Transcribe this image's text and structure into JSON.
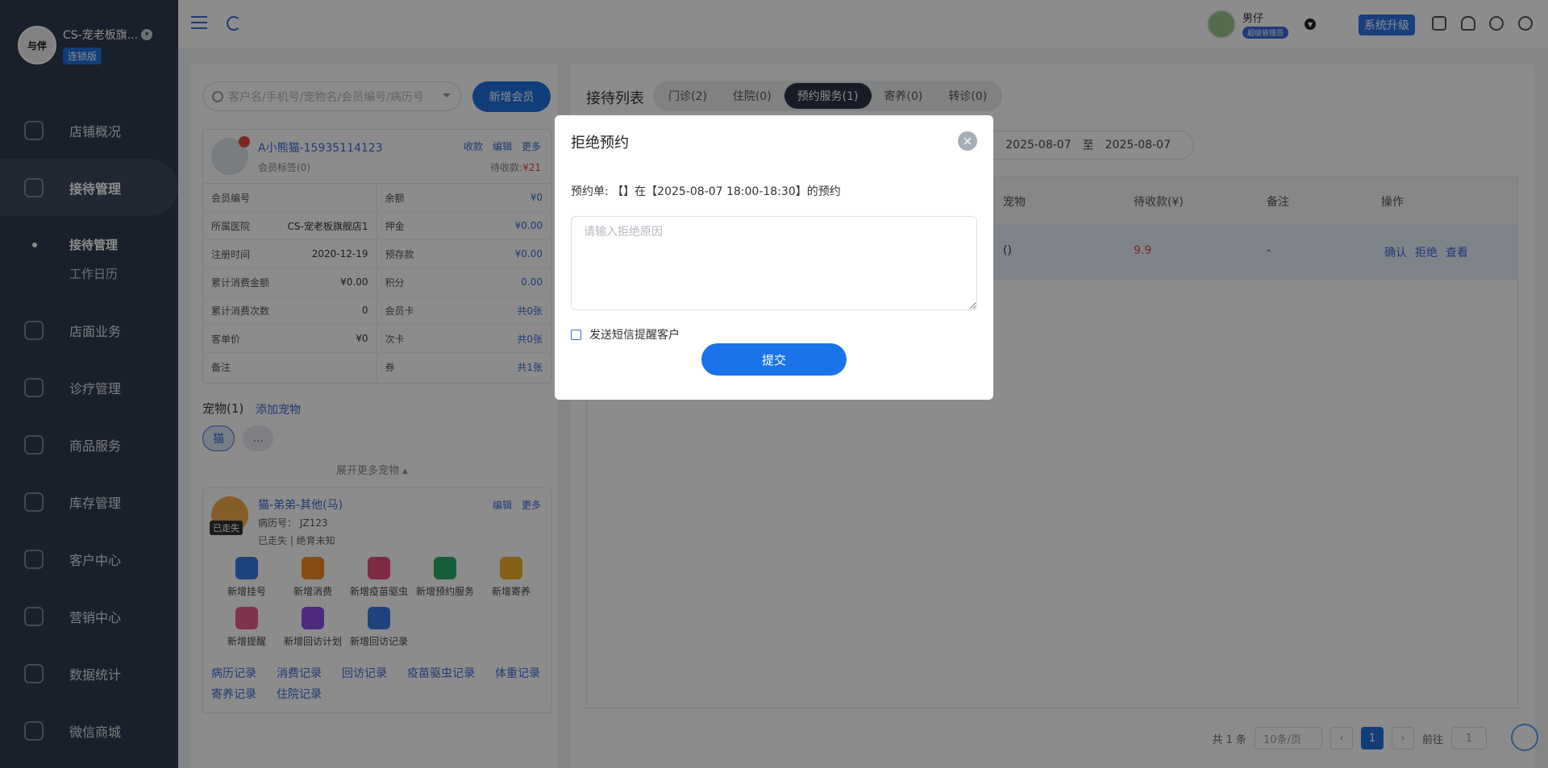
{
  "sidebar": {
    "brand_name": "CS-宠老板旗...",
    "brand_badge": "连锁版",
    "logo_text": "与伴",
    "items": [
      {
        "label": "店铺概况"
      },
      {
        "label": "接待管理"
      },
      {
        "label": "店面业务"
      },
      {
        "label": "诊疗管理"
      },
      {
        "label": "商品服务"
      },
      {
        "label": "库存管理"
      },
      {
        "label": "客户中心"
      },
      {
        "label": "营销中心"
      },
      {
        "label": "数据统计"
      },
      {
        "label": "微信商城"
      }
    ],
    "sub_items": [
      {
        "label": "接待管理"
      },
      {
        "label": "工作日历"
      }
    ]
  },
  "topbar": {
    "user_name": "男仔",
    "user_role": "超级管理员",
    "upgrade_label": "系统升级"
  },
  "left": {
    "search_placeholder": "客户名/手机号/宠物名/会员编号/病历号",
    "new_member_label": "新增会员",
    "member": {
      "name": "A小熊猫-15935114123",
      "tags": "会员标签(0)",
      "actions": [
        "收款",
        "编辑",
        "更多"
      ],
      "due_label": "待收款:",
      "due_value": "¥21",
      "rows": [
        {
          "k1": "会员编号",
          "v1": "",
          "k2": "余额",
          "v2": "¥0"
        },
        {
          "k1": "所属医院",
          "v1": "CS-宠老板旗舰店1",
          "k2": "押金",
          "v2": "¥0.00"
        },
        {
          "k1": "注册时间",
          "v1": "2020-12-19",
          "k2": "预存款",
          "v2": "¥0.00"
        },
        {
          "k1": "累计消费金额",
          "v1": "¥0.00",
          "k2": "积分",
          "v2": "0.00"
        },
        {
          "k1": "累计消费次数",
          "v1": "0",
          "k2": "会员卡",
          "v2": "共0张"
        },
        {
          "k1": "客单价",
          "v1": "¥0",
          "k2": "次卡",
          "v2": "共0张"
        },
        {
          "k1": "备注",
          "v1": "",
          "k2": "券",
          "v2": "共1张"
        }
      ]
    },
    "pets_title": "宠物(1)",
    "pets_add": "添加宠物",
    "pet_chip_selected": "猫",
    "pet_chip_more": "...",
    "expand_label": "展开更多宠物",
    "pet": {
      "name": "猫-弟弟-其他(马)",
      "lost_badge": "已走失",
      "record_no": "病历号： JZ123",
      "status": "已走失 | 绝育未知",
      "actions": [
        "编辑",
        "更多"
      ],
      "quick_actions": [
        {
          "label": "新增挂号",
          "color": "#3a7be8"
        },
        {
          "label": "新增消费",
          "color": "#f08a24"
        },
        {
          "label": "新增疫苗驱虫",
          "color": "#ea4d7a"
        },
        {
          "label": "新增预约服务",
          "color": "#2bab6a"
        },
        {
          "label": "新增寄养",
          "color": "#f2b02c"
        },
        {
          "label": "新增提醒",
          "color": "#ea5d8a"
        },
        {
          "label": "新增回访计划",
          "color": "#8a4ee6"
        },
        {
          "label": "新增回访记录",
          "color": "#3a7be8"
        }
      ],
      "records": [
        "病历记录",
        "消费记录",
        "回访记录",
        "疫苗驱虫记录",
        "体重记录",
        "寄养记录",
        "住院记录"
      ]
    }
  },
  "right": {
    "title": "接待列表",
    "tabs": [
      "门诊(2)",
      "住院(0)",
      "预约服务(1)",
      "寄养(0)",
      "转诊(0)"
    ],
    "date_from": "2025-08-07",
    "date_sep": "至",
    "date_to": "2025-08-07",
    "columns": [
      "宠物",
      "待收款(¥)",
      "备注",
      "操作"
    ],
    "row": {
      "pet": "()",
      "due": "9.9",
      "note": "-",
      "ops": [
        "确认",
        "拒绝",
        "查看"
      ]
    },
    "pager": {
      "total": "共 1 条",
      "per_page": "10条/页",
      "current": "1",
      "goto_label": "前往",
      "goto_value": "1"
    }
  },
  "modal": {
    "title": "拒绝预约",
    "close_icon": "×",
    "description": "预约单: 【】在【2025-08-07 18:00-18:30】的预约",
    "placeholder": "请输入拒绝原因",
    "sms_label": "发送短信提醒客户",
    "submit_label": "提交"
  }
}
